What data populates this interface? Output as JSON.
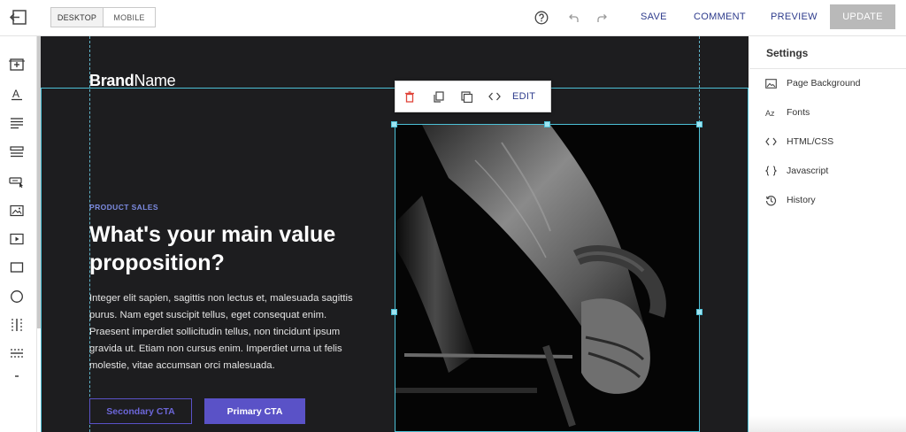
{
  "topbar": {
    "device_toggle": [
      "DESKTOP",
      "MOBILE"
    ],
    "active_device": "DESKTOP",
    "save_label": "SAVE",
    "comment_label": "COMMENT",
    "preview_label": "PREVIEW",
    "update_label": "UPDATE"
  },
  "canvas": {
    "brand_bold": "Brand",
    "brand_light": "Name",
    "eyebrow": "PRODUCT SALES",
    "headline": "What's your main value proposition?",
    "body": "Integer elit sapien, sagittis non lectus et, malesuada sagittis purus. Nam eget suscipit tellus, eget consequat enim. Praesent imperdiet sollicitudin tellus, non tincidunt ipsum gravida ut. Etiam non cursus enim. Imperdiet urna ut felis molestie, vitae accumsan orci malesuada.",
    "secondary_cta": "Secondary CTA",
    "primary_cta": "Primary CTA",
    "image_icon": "cyclist-photo"
  },
  "floating_toolbar": {
    "edit_label": "EDIT",
    "icons": [
      "trash-icon",
      "copy-icon",
      "duplicate-icon",
      "code-icon"
    ]
  },
  "settings": {
    "title": "Settings",
    "items": [
      {
        "label": "Page Background",
        "icon": "image-icon"
      },
      {
        "label": "Fonts",
        "icon": "fonts-icon"
      },
      {
        "label": "HTML/CSS",
        "icon": "code-icon"
      },
      {
        "label": "Javascript",
        "icon": "braces-icon"
      },
      {
        "label": "History",
        "icon": "history-icon"
      }
    ]
  },
  "colors": {
    "accent": "#5a52c7",
    "selection": "#4cc0d6",
    "link": "#2d3b8c",
    "canvas_bg": "#1d1d1f"
  }
}
